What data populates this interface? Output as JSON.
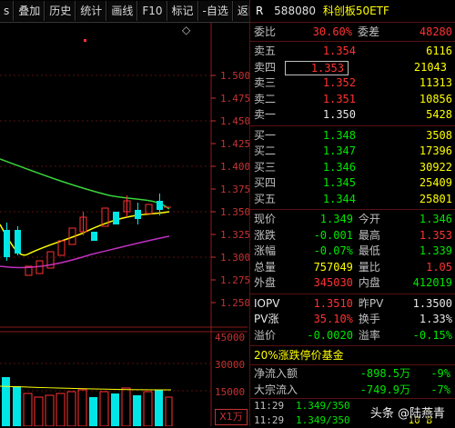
{
  "toolbar": {
    "items": [
      "s",
      "叠加",
      "历史",
      "统计",
      "画线",
      "F10",
      "标记",
      "-自选",
      "返回"
    ]
  },
  "chart": {
    "price_ticks": [
      "1.500",
      "1.475",
      "1.450",
      "1.425",
      "1.400",
      "1.375",
      "1.350",
      "1.325",
      "1.300",
      "1.275",
      "1.250"
    ],
    "volume_ticks": [
      "45000",
      "30000",
      "15000"
    ],
    "volume_unit": "X1万",
    "marker_symbol": "◇"
  },
  "quote": {
    "marker": "R",
    "code": "588080",
    "name": "科创板50ETF",
    "weibi_label": "委比",
    "weibi": "30.60%",
    "weicha_label": "委差",
    "weicha": "48280",
    "sells": [
      {
        "label": "卖五",
        "price": "1.354",
        "vol": "6116"
      },
      {
        "label": "卖四",
        "price": "1.353",
        "vol": "21043"
      },
      {
        "label": "卖三",
        "price": "1.352",
        "vol": "11313"
      },
      {
        "label": "卖二",
        "price": "1.351",
        "vol": "10856"
      },
      {
        "label": "卖一",
        "price": "1.350",
        "vol": "5428"
      }
    ],
    "buys": [
      {
        "label": "买一",
        "price": "1.348",
        "vol": "3508"
      },
      {
        "label": "买二",
        "price": "1.347",
        "vol": "17396"
      },
      {
        "label": "买三",
        "price": "1.346",
        "vol": "30922"
      },
      {
        "label": "买四",
        "price": "1.345",
        "vol": "25409"
      },
      {
        "label": "买五",
        "price": "1.344",
        "vol": "25801"
      }
    ],
    "stats": [
      {
        "l1": "现价",
        "v1": "1.349",
        "c1": "green",
        "l2": "今开",
        "v2": "1.346",
        "c2": "green"
      },
      {
        "l1": "涨跌",
        "v1": "-0.001",
        "c1": "green",
        "l2": "最高",
        "v2": "1.353",
        "c2": "red"
      },
      {
        "l1": "涨幅",
        "v1": "-0.07%",
        "c1": "green",
        "l2": "最低",
        "v2": "1.339",
        "c2": "green"
      },
      {
        "l1": "总量",
        "v1": "757049",
        "c1": "yellow",
        "l2": "量比",
        "v2": "1.05",
        "c2": "red"
      },
      {
        "l1": "外盘",
        "v1": "345030",
        "c1": "red",
        "l2": "内盘",
        "v2": "412019",
        "c2": "green"
      }
    ],
    "stats2": [
      {
        "l1": "IOPV",
        "v1": "1.3510",
        "c1": "red",
        "l2": "昨PV",
        "v2": "1.3500",
        "c2": "white"
      },
      {
        "l1": "PV涨",
        "v1": "35.10%",
        "c1": "red",
        "l2": "换手",
        "v2": "1.33%",
        "c2": "white"
      },
      {
        "l1": "溢价",
        "v1": "-0.0020",
        "c1": "green",
        "l2": "溢率",
        "v2": "-0.15%",
        "c2": "green"
      }
    ],
    "fund_title": "20%涨跌停价基金",
    "flows": [
      {
        "label": "净流入额",
        "value": "-898.5万",
        "pct": "-9%"
      },
      {
        "label": "大宗流入",
        "value": "-749.9万",
        "pct": "-7%"
      }
    ],
    "ticks": [
      {
        "time": "11:29",
        "price": "1.349/350",
        "vol": "_"
      },
      {
        "time": "11:29",
        "price": "1.349/350",
        "vol": "10 B"
      }
    ],
    "watermark": "头条 @陆燕青"
  },
  "colors": {
    "up": "#ff3232",
    "down": "#00e600",
    "ma1": "#ffff00",
    "ma2": "#39d339",
    "ma3": "#c030c0"
  }
}
